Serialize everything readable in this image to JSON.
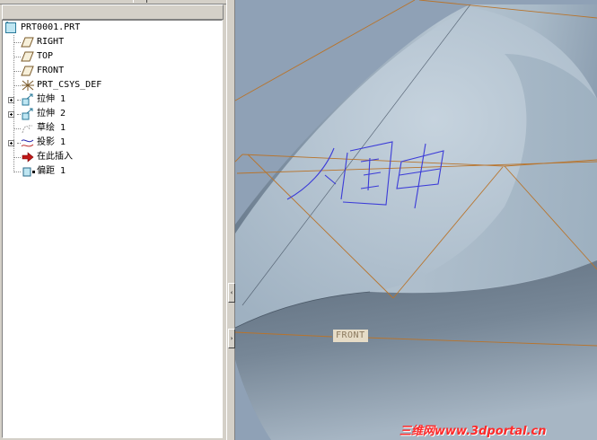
{
  "model_tree": {
    "items": [
      {
        "label": "PRT0001.PRT",
        "icon": "part-icon"
      },
      {
        "label": "RIGHT",
        "icon": "datum-plane-icon"
      },
      {
        "label": "TOP",
        "icon": "datum-plane-icon"
      },
      {
        "label": "FRONT",
        "icon": "datum-plane-icon"
      },
      {
        "label": "PRT_CSYS_DEF",
        "icon": "coordinate-system-icon"
      },
      {
        "label": "拉伸 1",
        "icon": "extrude-icon"
      },
      {
        "label": "拉伸 2",
        "icon": "extrude-icon"
      },
      {
        "label": "草绘 1",
        "icon": "sketch-icon"
      },
      {
        "label": "投影 1",
        "icon": "projection-icon"
      },
      {
        "label": "在此插入",
        "icon": "insert-here-arrow-icon"
      },
      {
        "label": "偏距 1",
        "icon": "offset-feature-icon"
      }
    ]
  },
  "viewport": {
    "datum_label": "FRONT",
    "projected_text": "個中",
    "watermark": "三维网www.3dportal.cn"
  },
  "colors": {
    "surface_light": "#b8c7d3",
    "surface_dark": "#5f6f80",
    "background": "#8fa1b6",
    "datum_line": "#c07a2c",
    "projected_curve": "#3b3bd8",
    "watermark": "#ff2a2a"
  }
}
